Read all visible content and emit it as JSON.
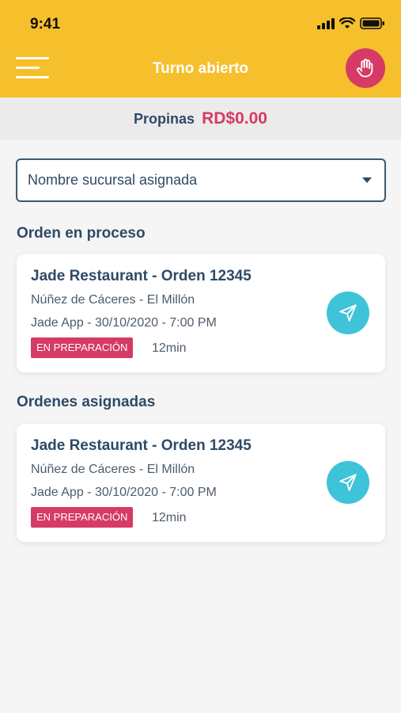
{
  "status_bar": {
    "time": "9:41"
  },
  "header": {
    "title": "Turno abierto"
  },
  "tips": {
    "label": "Propinas",
    "amount": "RD$0.00"
  },
  "branch_select": {
    "selected": "Nombre sucursal asignada"
  },
  "sections": {
    "in_process": "Orden en proceso",
    "assigned": "Ordenes asignadas"
  },
  "orders": [
    {
      "title": "Jade Restaurant - Orden 12345",
      "address": "Núñez de Cáceres - El Millón",
      "source": "Jade App - 30/10/2020 - 7:00 PM",
      "status": "EN PREPARACIÓN",
      "elapsed": "12min"
    },
    {
      "title": "Jade Restaurant - Orden 12345",
      "address": "Núñez de Cáceres - El Millón",
      "source": "Jade App - 30/10/2020 - 7:00 PM",
      "status": "EN PREPARACIÓN",
      "elapsed": "12min"
    }
  ],
  "colors": {
    "header": "#f6bf2c",
    "accent": "#d63a65",
    "navigate": "#3ec3d8",
    "text": "#2e4a66"
  },
  "icons": {
    "menu": "hamburger-menu-icon",
    "hand": "hand-icon",
    "navigate": "navigation-arrow-icon",
    "dropdown": "caret-down-icon"
  }
}
